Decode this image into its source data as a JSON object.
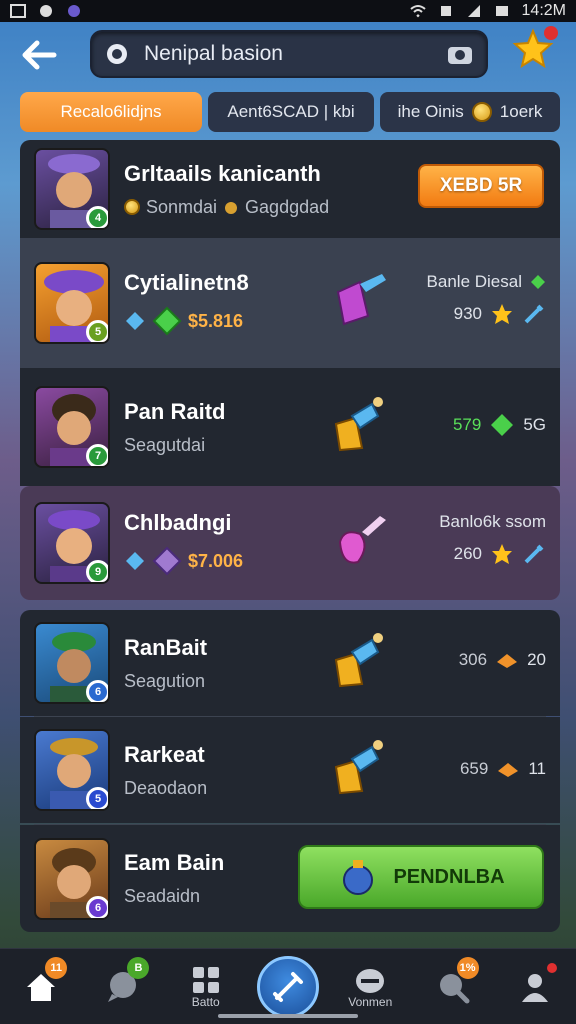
{
  "status_bar": {
    "time": "14:2M"
  },
  "header": {
    "search_value": "Nenipal basion"
  },
  "tabs": [
    {
      "label": "Recalo6lidjns"
    },
    {
      "label": "Aent6SCAD |  kbi"
    },
    {
      "label": "ihe Oinis"
    },
    {
      "label": "1oerk"
    }
  ],
  "rows": [
    {
      "name": "Grltaails kanicanth",
      "sub1": "Sonmdai",
      "sub2": "Gagdgdad",
      "button": "XEBD 5R"
    },
    {
      "name": "Cytialinetn8",
      "value": "$5.816",
      "right_title": "Banle Diesal",
      "right_value": "930"
    },
    {
      "name": "Pan Raitd",
      "sub": "Seagutdai",
      "stat1": "579",
      "stat2": "5G"
    },
    {
      "name": "Chlbadngi",
      "value": "$7.006",
      "right_title": "Banlo6k ssom",
      "right_value": "260"
    },
    {
      "name": "RanBait",
      "sub": "Seagution",
      "stat1": "306",
      "stat2": "20"
    },
    {
      "name": "Rarkeat",
      "sub": "Deaodaon",
      "stat1": "659",
      "stat2": "11"
    },
    {
      "name": "Eam Bain",
      "sub": "Seadaidn",
      "button": "PENDNLBA"
    }
  ],
  "avatar_badges": [
    "4",
    "5",
    "7",
    "9",
    "6",
    "5",
    "6"
  ],
  "bottom_nav": {
    "home_badge": "11",
    "chat_badge": "B",
    "grid_label": "Batto",
    "profile_label": "Vonmen",
    "search_badge": "1%"
  },
  "colors": {
    "accent_orange": "#f08a26",
    "accent_green": "#4aa82a",
    "panel": "#222730"
  }
}
